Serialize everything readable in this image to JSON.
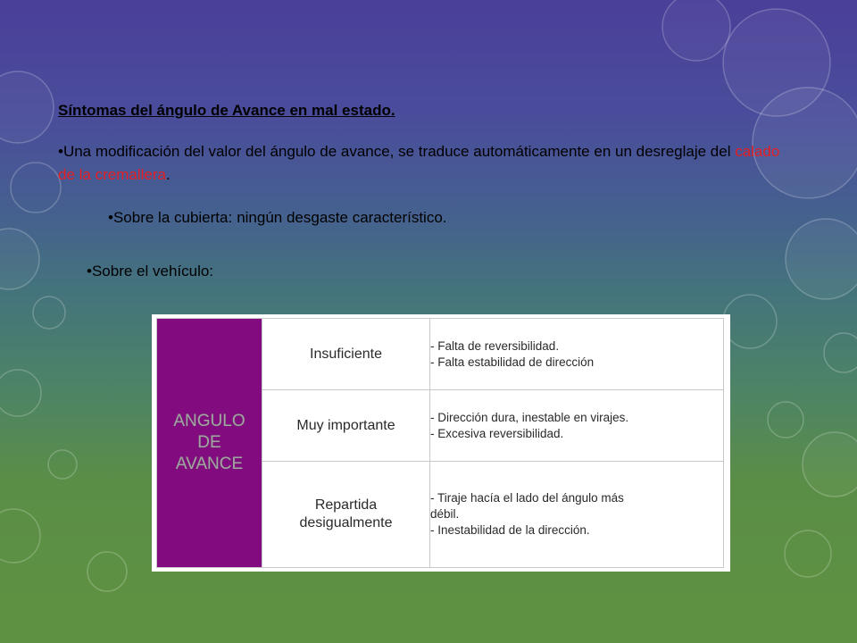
{
  "slide": {
    "title": "Síntomas del ángulo de Avance en mal estado.",
    "paragraph": {
      "bullet": "•",
      "text_before": "Una modificación del valor del ángulo de avance, se traduce automáticamente en un desreglaje del ",
      "highlight": "calado de la cremallera",
      "text_after": "."
    },
    "cubierta": {
      "label": "•Sobre la cubierta:",
      "value": "ningún desgaste característico."
    },
    "vehiculo": {
      "label": "•Sobre el vehículo:"
    },
    "colors": {
      "highlight": "#e31e24",
      "table_header_bg": "#820c7f"
    }
  },
  "table": {
    "header_lines": [
      "ANGULO",
      "DE",
      "AVANCE"
    ],
    "rows": [
      {
        "level_lines": [
          "Insuficiente"
        ],
        "effects": [
          "- Falta de reversibilidad.",
          "- Falta estabilidad de dirección"
        ]
      },
      {
        "level_lines": [
          "Muy importante"
        ],
        "effects": [
          "- Dirección dura, inestable en virajes.",
          "- Excesiva reversibilidad."
        ]
      },
      {
        "level_lines": [
          "Repartida",
          "desigualmente"
        ],
        "effects": [
          "- Tiraje hacía el lado del ángulo más",
          "débil.",
          "- Inestabilidad de la dirección."
        ]
      }
    ]
  }
}
